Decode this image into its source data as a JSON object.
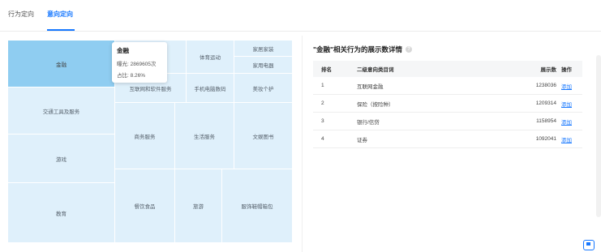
{
  "tabs": [
    {
      "label": "行为定向",
      "active": false
    },
    {
      "label": "意向定向",
      "active": true
    }
  ],
  "treemap": {
    "cells": {
      "finance": "金融",
      "sports": "体育运动",
      "home_appliance": "家居家装",
      "appliance": "家用电器",
      "internet_software": "互联网和软件服务",
      "phone_digital": "手机电脑数码",
      "beauty": "美妆个护",
      "transport": "交通工具及服务",
      "business": "商务服务",
      "life": "生活服务",
      "culture_books": "文娱图书",
      "games": "游戏",
      "education": "教育",
      "food": "餐饮食品",
      "travel": "旅游",
      "apparel": "服饰鞋帽箱包"
    },
    "tooltip": {
      "title": "金融",
      "exposure": "曝光: 2869605次",
      "share": "占比: 8.26%"
    }
  },
  "panel": {
    "title": "\"金融\"相关行为的展示数详情",
    "info_icon": "info-icon",
    "columns": [
      "排名",
      "二级意向类目词",
      "展示数",
      "操作"
    ],
    "rows": [
      {
        "rank": "1",
        "name": "互联网金融",
        "count": "1238036",
        "action": "添加"
      },
      {
        "rank": "2",
        "name": "保险（按险种）",
        "count": "1209314",
        "action": "添加"
      },
      {
        "rank": "3",
        "name": "银行/信贷",
        "count": "1158954",
        "action": "添加"
      },
      {
        "rank": "4",
        "name": "证券",
        "count": "1092041",
        "action": "添加"
      }
    ]
  },
  "colors": {
    "accent": "#1677ff",
    "treemap_cell": "#dff0fb",
    "treemap_selected": "#8fcdf1"
  }
}
